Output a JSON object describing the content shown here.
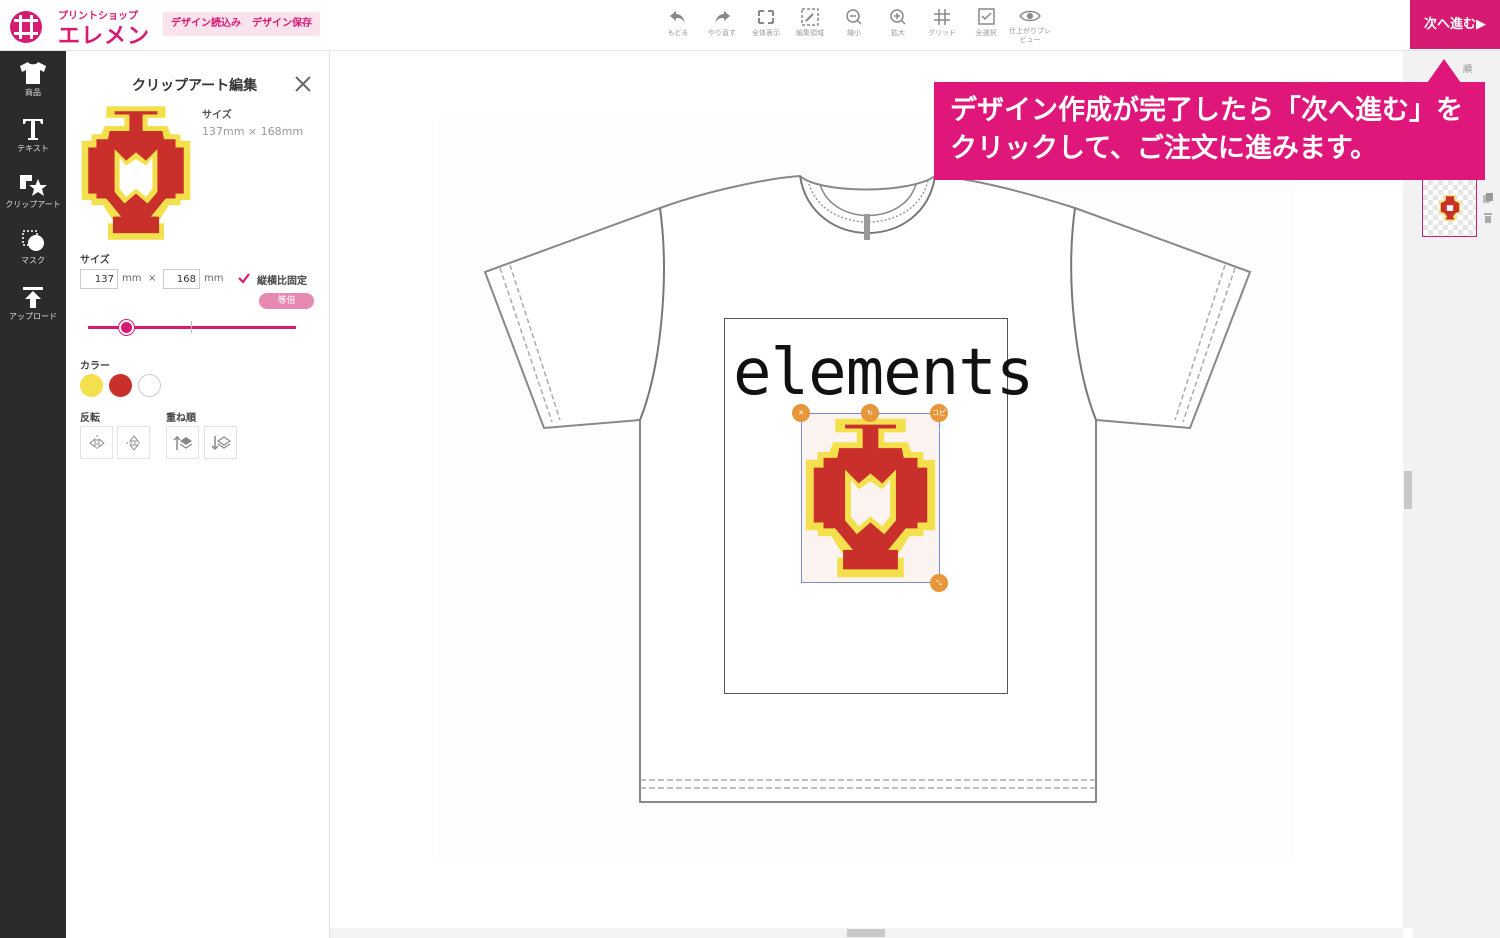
{
  "header": {
    "logo_small": "プリントショップ",
    "logo_big": "エレメンツ",
    "load_design": "デザイン読込み",
    "save_design": "デザイン保存",
    "next": "次へ進む▶",
    "tools": [
      {
        "label": "もどる",
        "icon": "undo-icon"
      },
      {
        "label": "やり直す",
        "icon": "redo-icon"
      },
      {
        "label": "全体表示",
        "icon": "fit-screen-icon"
      },
      {
        "label": "編集領域",
        "icon": "edit-area-icon"
      },
      {
        "label": "縮小",
        "icon": "zoom-out-icon"
      },
      {
        "label": "拡大",
        "icon": "zoom-in-icon"
      },
      {
        "label": "グリッド",
        "icon": "grid-icon"
      },
      {
        "label": "全選択",
        "icon": "select-all-icon"
      },
      {
        "label": "仕上がりプレビュー",
        "icon": "eye-icon"
      }
    ]
  },
  "sidebar": {
    "items": [
      {
        "label": "商品",
        "icon": "tshirt-icon"
      },
      {
        "label": "テキスト",
        "icon": "text-icon"
      },
      {
        "label": "クリップアート",
        "icon": "clipart-icon"
      },
      {
        "label": "マスク",
        "icon": "mask-icon"
      },
      {
        "label": "アップロード",
        "icon": "upload-icon"
      }
    ]
  },
  "panel": {
    "title": "クリップアート編集",
    "size_label": "サイズ",
    "size_value": "137mm × 168mm",
    "size_section": "サイズ",
    "width": "137",
    "height": "168",
    "unit": "mm",
    "times": "×",
    "lock_ratio": "縦横比固定",
    "lock_ratio_checked": true,
    "reset_scale": "等倍",
    "scale_slider": 0.18,
    "color_label": "カラー",
    "colors": [
      "#f4e04d",
      "#c9302c",
      "#ffffff"
    ],
    "flip_label": "反転",
    "order_label": "重ね順"
  },
  "callout": {
    "line1": "デザイン作成が完了したら「次へ進む」を",
    "line2": "クリックして、ご注文に進みます。"
  },
  "design": {
    "text": "elements",
    "copy_handle": "コピー"
  },
  "right_panel": {
    "order_label": "順"
  }
}
